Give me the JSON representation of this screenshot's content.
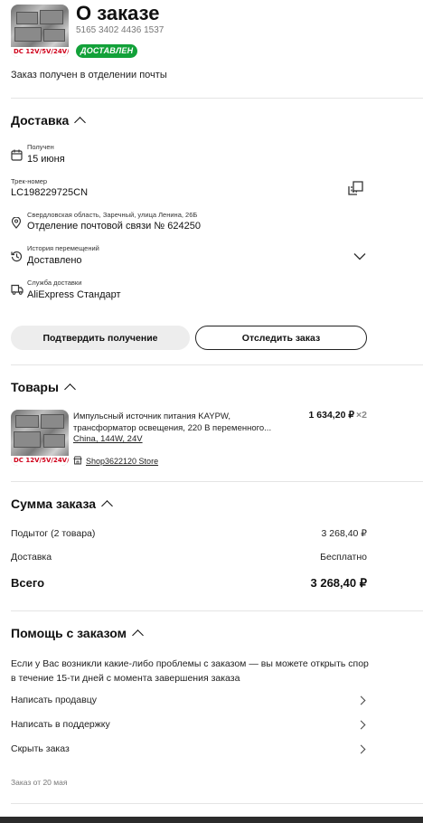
{
  "header": {
    "title": "О заказе",
    "order_number": "5165 3402 4436 1537",
    "status": "ДОСТАВЛЕН",
    "status_color": "#12a139",
    "note": "Заказ получен в отделении почты",
    "thumb_caption": "DC 12V/5V/24V/48V"
  },
  "delivery": {
    "title": "Доставка",
    "received_label": "Получен",
    "received_value": "15 июня",
    "track_label": "Трек-номер",
    "track_value": "LC198229725CN",
    "address_label": "Свердловская область, Заречный, улица Ленина, 26Б",
    "address_value": "Отделение почтовой связи № 624250",
    "history_label": "История перемещений",
    "history_value": "Доставлено",
    "service_label": "Служба доставки",
    "service_value": "AliExpress Стандарт",
    "confirm_button": "Подтвердить получение",
    "track_button": "Отследить заказ"
  },
  "goods": {
    "title": "Товары",
    "item_name": "Импульсный источник питания KAYPW, трансформатор освещения, 220 В переменного...",
    "item_variant": "China, 144W, 24V",
    "item_price": "1 634,20 ₽",
    "item_qty": "×2",
    "store": "Shop3622120 Store",
    "thumb_caption": "DC 12V/5V/24V/48V"
  },
  "summary": {
    "title": "Сумма заказа",
    "subtotal_label": "Подытог (2 товара)",
    "subtotal_value": "3 268,40 ₽",
    "shipping_label": "Доставка",
    "shipping_value": "Бесплатно",
    "total_label": "Всего",
    "total_value": "3 268,40 ₽"
  },
  "help": {
    "title": "Помощь с заказом",
    "text": "Если у Вас возникли какие-либо проблемы с заказом — вы можете открыть спор в течение 15-ти дней с момента завершения заказа",
    "write_seller": "Написать продавцу",
    "write_support": "Написать в поддержку",
    "hide_order": "Скрыть заказ"
  },
  "footer": {
    "order_date": "Заказ от 20 мая"
  }
}
